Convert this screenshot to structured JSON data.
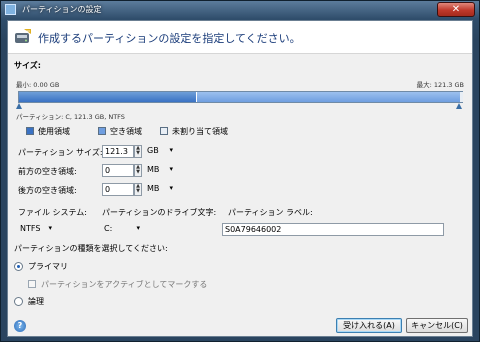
{
  "window": {
    "title": "パーティションの設定",
    "close_glyph": "✕"
  },
  "header": {
    "instruction": "作成するパーティションの設定を指定してください。",
    "icon": "disk-wizard-icon"
  },
  "size_section": {
    "label": "サイズ:",
    "min_text": "最小: 0.00 GB",
    "max_text": "最大: 121.3 GB",
    "partition_caption": "パーティション: C, 121.3 GB, NTFS",
    "bar_used_fraction": 0.4,
    "colors": {
      "used": "#3a72c4",
      "partition": "#6f9ee0",
      "free": "#e8eef5"
    }
  },
  "legend": [
    {
      "label": "使用領域",
      "color": "#3a72c4"
    },
    {
      "label": "空き領域",
      "color": "#6f9ee0"
    },
    {
      "label": "未割り当て領域",
      "color": "#e8eef5"
    }
  ],
  "params": {
    "size_label": "パーティション サイズ:",
    "size_value": "121.3",
    "size_unit": "GB",
    "free_before_label": "前方の空き領域:",
    "free_before_value": "0",
    "free_before_unit": "MB",
    "free_after_label": "後方の空き領域:",
    "free_after_value": "0",
    "free_after_unit": "MB"
  },
  "fs": {
    "filesystem_label": "ファイル システム:",
    "filesystem_value": "NTFS",
    "drive_letter_label": "パーティションのドライブ文字:",
    "drive_letter_value": "C:",
    "volume_label_label": "パーティション ラベル:",
    "volume_label_value": "S0A79646002"
  },
  "type_section": {
    "label": "パーティションの種類を選択してください:",
    "primary_label": "プライマリ",
    "active_label": "パーティションをアクティブとしてマークする",
    "logical_label": "論理",
    "primary_selected": true
  },
  "buttons": {
    "accept": "受け入れる(A)",
    "cancel": "キャンセル(C)",
    "help_glyph": "?"
  }
}
